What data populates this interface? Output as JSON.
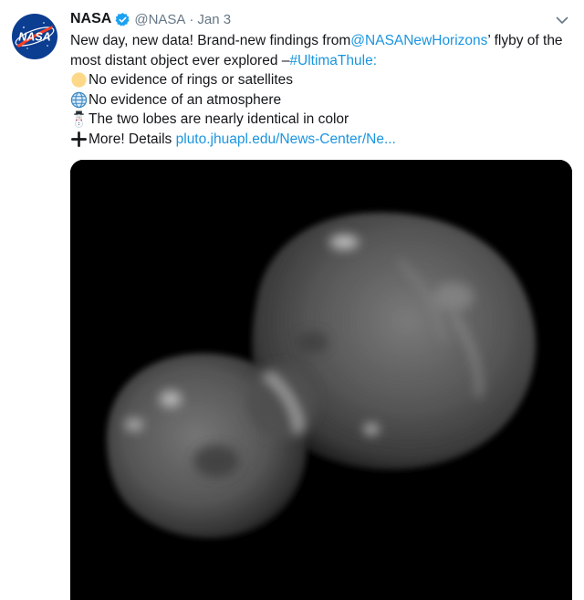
{
  "tweet": {
    "author_name": "NASA",
    "author_handle": "@NASA",
    "separator": "·",
    "date": "Jan 3",
    "avatar_text": "NASA",
    "line1_text": "New day, new data! Brand-new findings from ",
    "mention": "@NASANewHorizons",
    "line1_tail": "’ flyby of the",
    "line2_text": "most distant object ever explored – ",
    "hashtag": "#UltimaThule",
    "line2_tail": ":",
    "finding1": "No evidence of rings or satellites",
    "finding2": "No evidence of an atmosphere",
    "finding3": "The two lobes are nearly identical in color",
    "more_prefix": "More! Details ",
    "details_link": "pluto.jhuapl.edu/News-Center/Ne...",
    "icons": [
      "nasa-logo",
      "verified-badge-icon",
      "chevron-down-icon",
      "yellow-circle-icon",
      "globe-icon",
      "snowman-icon",
      "plus-icon"
    ],
    "colors": {
      "link": "#1b95e0",
      "name": "#14171a",
      "meta": "#657786",
      "nasa_blue": "#0b3d91",
      "nasa_red": "#fc3d21"
    }
  }
}
